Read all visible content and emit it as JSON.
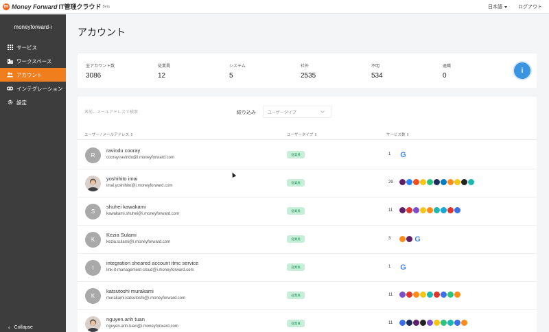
{
  "app": {
    "brand": "Money Forward",
    "product": "IT管理クラウド",
    "beta": "Beta",
    "language": "日本語",
    "logout": "ログアウト"
  },
  "sidebar": {
    "org_name": "moneyforward-i",
    "items": [
      {
        "label": "サービス",
        "icon": "grid-icon",
        "active": false
      },
      {
        "label": "ワークスペース",
        "icon": "building-icon",
        "active": false
      },
      {
        "label": "アカウント",
        "icon": "users-icon",
        "active": true
      },
      {
        "label": "インテグレーション",
        "icon": "link-icon",
        "active": false
      },
      {
        "label": "設定",
        "icon": "gear-icon",
        "active": false
      }
    ],
    "collapse": "Collapse"
  },
  "page": {
    "title": "アカウント"
  },
  "stats": [
    {
      "label": "全アカウント数",
      "value": "3086"
    },
    {
      "label": "従業員",
      "value": "12"
    },
    {
      "label": "システム",
      "value": "5"
    },
    {
      "label": "社外",
      "value": "2535"
    },
    {
      "label": "不明",
      "value": "534"
    },
    {
      "label": "退職",
      "value": "0"
    }
  ],
  "info_button": "i",
  "search": {
    "placeholder": "名前、メールアドレスで検索"
  },
  "filter": {
    "label": "絞り込み",
    "placeholder": "ユーザータイプ"
  },
  "columns": {
    "user": "ユーザー / メールアドレス ⇕",
    "type": "ユーザータイプ ⇕",
    "services": "サービス数 ⇕"
  },
  "colors": {
    "accent": "#f07e1d",
    "sidebar": "#3d3d3d",
    "badge_bg": "#c7eed9",
    "badge_text": "#2d9b63",
    "info": "#3b94e0"
  },
  "rows": [
    {
      "initial": "R",
      "name": "ravindu cooray",
      "email": "cooray.ravindu@i.moneyforward.com",
      "type": "従業員",
      "count": "1",
      "icons": [
        "google"
      ]
    },
    {
      "initial": "",
      "name": "yoshihito imai",
      "email": "imai.yoshihito@i.moneyforward.com",
      "type": "従業員",
      "count": "29",
      "icons": [
        "slack",
        "jira",
        "figma",
        "yellow",
        "green",
        "navy",
        "okta",
        "orange",
        "yellow",
        "dark",
        "teal"
      ]
    },
    {
      "initial": "S",
      "name": "shuhei kawakami",
      "email": "kawakami.shuhei@i.moneyforward.com",
      "type": "従業員",
      "count": "11",
      "icons": [
        "slack",
        "red",
        "purple",
        "yellow",
        "orange",
        "teal",
        "cyan",
        "red",
        "blue"
      ]
    },
    {
      "initial": "K",
      "name": "Kezia Sulami",
      "email": "kezia.sulami@i.moneyforward.com",
      "type": "従業員",
      "count": "3",
      "icons": [
        "orange",
        "slack",
        "google"
      ]
    },
    {
      "initial": "I",
      "name": "integration sheared account itmc service",
      "email": "link-it-management-cloud@i.moneyforward.com",
      "type": "従業員",
      "count": "1",
      "icons": [
        "google"
      ]
    },
    {
      "initial": "K",
      "name": "katsutoshi murakami",
      "email": "murakami.katsutoshi@i.moneyforward.com",
      "type": "従業員",
      "count": "11",
      "icons": [
        "purple",
        "red",
        "orange",
        "yellow",
        "teal",
        "red",
        "blue",
        "green",
        "orange"
      ]
    },
    {
      "initial": "",
      "name": "nguyen.anh tuan",
      "email": "nguyen.anh.tuan@i.moneyforward.com",
      "type": "従業員",
      "count": "11",
      "icons": [
        "blue",
        "navy",
        "slack",
        "dark",
        "purple",
        "yellow",
        "green",
        "teal",
        "blue",
        "orange"
      ]
    }
  ]
}
